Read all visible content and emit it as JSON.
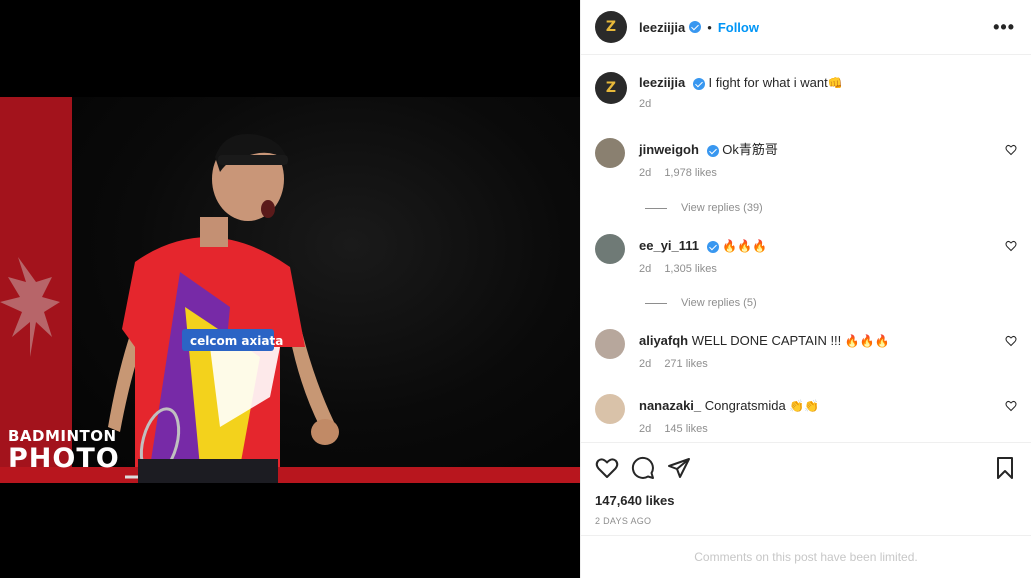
{
  "post": {
    "username": "leeziijia",
    "follow_label": "Follow",
    "more_label": "•••",
    "separator": "•"
  },
  "watermark": {
    "line1": "BADMINTON",
    "line2": "PHOTO"
  },
  "caption": {
    "username": "leeziijia",
    "text": "I fight for what i want",
    "emoji": "👊",
    "age": "2d"
  },
  "comments": [
    {
      "username": "jinweigoh",
      "verified": true,
      "text": "Ok青筋哥",
      "age": "2d",
      "likes": "1,978 likes",
      "replies": "View replies (39)",
      "avatar_color": "#8a8070"
    },
    {
      "username": "ee_yi_111",
      "verified": true,
      "text": "",
      "emoji": "🔥🔥🔥",
      "age": "2d",
      "likes": "1,305 likes",
      "replies": "View replies (5)",
      "avatar_color": "#6f7a76"
    },
    {
      "username": "aliyafqh",
      "verified": false,
      "text": "WELL DONE CAPTAIN !!! ",
      "emoji": "🔥🔥🔥",
      "age": "2d",
      "likes": "271 likes",
      "avatar_color": "#b7a79c"
    },
    {
      "username": "nanazaki_",
      "verified": false,
      "text": "Congratsmida ",
      "emoji": "👏👏",
      "age": "2d",
      "likes": "145 likes",
      "avatar_color": "#d9c2a9"
    }
  ],
  "footer": {
    "likes": "147,640 likes",
    "date": "2 DAYS AGO",
    "limited": "Comments on this post have been limited."
  },
  "colors": {
    "link": "#0095f6",
    "verified": "#3897f0",
    "muted": "#8e8e8e",
    "photo_red": "#a3131c"
  }
}
